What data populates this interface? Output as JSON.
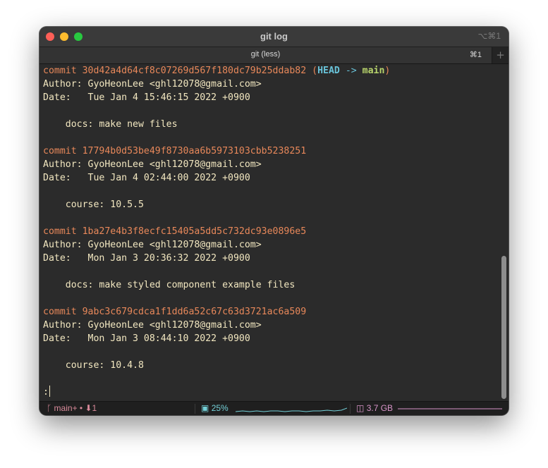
{
  "window": {
    "title": "git log",
    "shortcut": "⌥⌘1"
  },
  "tab": {
    "title": "git (less)",
    "shortcut": "⌘1",
    "new_tab": "+"
  },
  "commits": [
    {
      "keyword": "commit",
      "hash": "30d42a4d64cf8c07269d567f180dc79b25ddab82",
      "head": "HEAD",
      "arrow": "->",
      "branch": "main",
      "author": "Author: GyoHeonLee <ghl12078@gmail.com>",
      "date": "Date:   Tue Jan 4 15:46:15 2022 +0900",
      "message": "    docs: make new files"
    },
    {
      "keyword": "commit",
      "hash": "17794b0d53be49f8730aa6b5973103cbb5238251",
      "author": "Author: GyoHeonLee <ghl12078@gmail.com>",
      "date": "Date:   Tue Jan 4 02:44:00 2022 +0900",
      "message": "    course: 10.5.5"
    },
    {
      "keyword": "commit",
      "hash": "1ba27e4b3f8ecfc15405a5dd5c732dc93e0896e5",
      "author": "Author: GyoHeonLee <ghl12078@gmail.com>",
      "date": "Date:   Mon Jan 3 20:36:32 2022 +0900",
      "message": "    docs: make styled component example files"
    },
    {
      "keyword": "commit",
      "hash": "9abc3c679cdca1f1dd6a52c67c63d3721ac6a509",
      "author": "Author: GyoHeonLee <ghl12078@gmail.com>",
      "date": "Date:   Mon Jan 3 08:44:10 2022 +0900",
      "message": "    course: 10.4.8"
    }
  ],
  "prompt": ":",
  "statusbar": {
    "branch_icon": "ᚴ",
    "branch": "main",
    "branch_suffix": "+ • ⬇1",
    "cpu_icon": "▣",
    "cpu": "25%",
    "memory_icon": "◫",
    "memory": "3.7 GB",
    "cpu_color": "#74d0d8",
    "memory_color": "#d995c9"
  }
}
